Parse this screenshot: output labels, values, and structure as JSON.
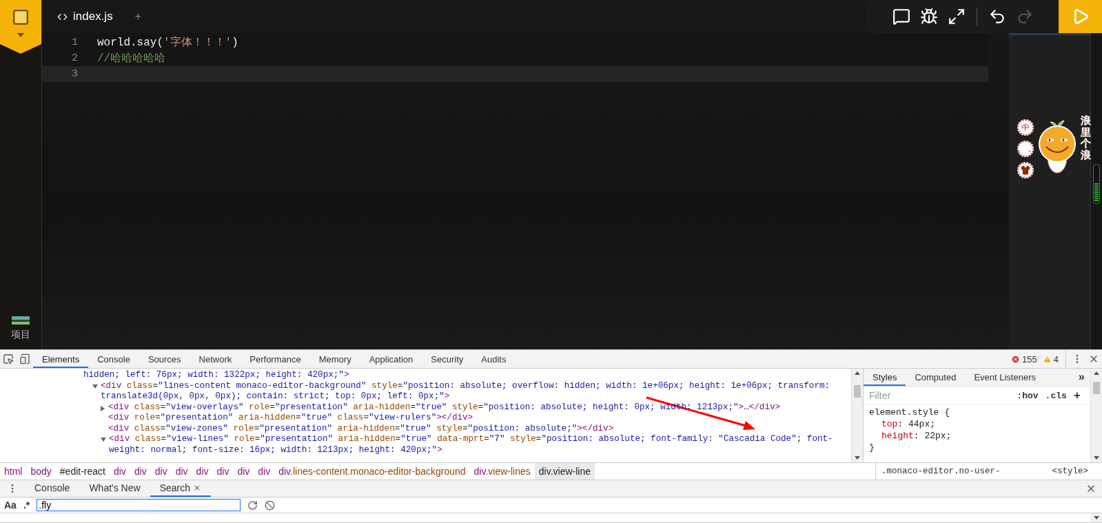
{
  "sidebar": {
    "items": [
      {
        "label": "项目"
      }
    ]
  },
  "editor": {
    "tabs": [
      {
        "label": "index.js",
        "selected": true
      }
    ],
    "add_tab": "+",
    "lines": [
      {
        "number": "1",
        "current": false,
        "tokens": [
          {
            "kind": "code",
            "text": "world.say("
          },
          {
            "kind": "string",
            "text": "'字体！！！'"
          },
          {
            "kind": "code",
            "text": ")"
          }
        ]
      },
      {
        "number": "2",
        "current": false,
        "tokens": [
          {
            "kind": "comment",
            "text": "//哈哈哈哈哈"
          }
        ]
      },
      {
        "number": "3",
        "current": true
      }
    ]
  },
  "toolbar": {
    "groups": [
      {
        "buttons": [
          {
            "kind": "comment",
            "disabled": false
          },
          {
            "kind": "bug",
            "disabled": false
          },
          {
            "kind": "fullscreen",
            "disabled": false
          }
        ]
      },
      {
        "buttons": [
          {
            "kind": "undo",
            "disabled": false
          },
          {
            "kind": "redo",
            "disabled": true
          }
        ]
      }
    ],
    "run": {
      "disabled": false
    }
  },
  "sticker": {
    "buttons": [
      {
        "kind": "text",
        "label": "中"
      },
      {
        "kind": "text",
        "label": "。，"
      },
      {
        "kind": "shirt"
      }
    ],
    "caption": "浪里个浪"
  },
  "devtools": {
    "tabs": [
      {
        "label": "Elements",
        "selected": true
      },
      {
        "label": "Console",
        "selected": false
      },
      {
        "label": "Sources",
        "selected": false
      },
      {
        "label": "Network",
        "selected": false
      },
      {
        "label": "Performance",
        "selected": false
      },
      {
        "label": "Memory",
        "selected": false
      },
      {
        "label": "Application",
        "selected": false
      },
      {
        "label": "Security",
        "selected": false
      },
      {
        "label": "Audits",
        "selected": false
      }
    ],
    "errors": "155",
    "warnings": "4",
    "dom": [
      {
        "kind": "fragment",
        "tokens": [
          {
            "kind": "value",
            "text": "hidden; left: 76px; width: 1322px; height: 420px;\""
          },
          {
            "kind": "tag",
            "text": ">"
          }
        ]
      },
      {
        "kind": "element",
        "expanded": true,
        "tokens": [
          {
            "kind": "tag",
            "text": "<div"
          },
          {
            "kind": "attr",
            "text": " class"
          },
          {
            "kind": "plain",
            "text": "="
          },
          {
            "kind": "value",
            "text": "\"lines-content monaco-editor-background\""
          },
          {
            "kind": "attr",
            "text": " style"
          },
          {
            "kind": "plain",
            "text": "="
          },
          {
            "kind": "value",
            "text": "\"position: absolute; overflow: hidden; width: 1e+06px; height: 1e+06px; transform: translate3d(0px, 0px, 0px); contain: strict; top: 0px; left: 0px;\""
          },
          {
            "kind": "tag",
            "text": ">"
          }
        ],
        "children": [
          {
            "kind": "element",
            "expanded": false,
            "tokens": [
              {
                "kind": "tag",
                "text": "<div"
              },
              {
                "kind": "attr",
                "text": " class"
              },
              {
                "kind": "plain",
                "text": "="
              },
              {
                "kind": "value",
                "text": "\"view-overlays\""
              },
              {
                "kind": "attr",
                "text": " role"
              },
              {
                "kind": "plain",
                "text": "="
              },
              {
                "kind": "value",
                "text": "\"presentation\""
              },
              {
                "kind": "attr",
                "text": " aria-hidden"
              },
              {
                "kind": "plain",
                "text": "="
              },
              {
                "kind": "value",
                "text": "\"true\""
              },
              {
                "kind": "attr",
                "text": " style"
              },
              {
                "kind": "plain",
                "text": "="
              },
              {
                "kind": "value",
                "text": "\"position: absolute; height: 0px; width: 1213px;\""
              },
              {
                "kind": "tag",
                "text": ">"
              },
              {
                "kind": "plain",
                "text": "…"
              },
              {
                "kind": "tag",
                "text": "</div>"
              }
            ]
          },
          {
            "kind": "element",
            "tokens": [
              {
                "kind": "tag",
                "text": "<div"
              },
              {
                "kind": "attr",
                "text": " role"
              },
              {
                "kind": "plain",
                "text": "="
              },
              {
                "kind": "value",
                "text": "\"presentation\""
              },
              {
                "kind": "attr",
                "text": " aria-hidden"
              },
              {
                "kind": "plain",
                "text": "="
              },
              {
                "kind": "value",
                "text": "\"true\""
              },
              {
                "kind": "attr",
                "text": " class"
              },
              {
                "kind": "plain",
                "text": "="
              },
              {
                "kind": "value",
                "text": "\"view-rulers\""
              },
              {
                "kind": "tag",
                "text": "></div>"
              }
            ]
          },
          {
            "kind": "element",
            "tokens": [
              {
                "kind": "tag",
                "text": "<div"
              },
              {
                "kind": "attr",
                "text": " class"
              },
              {
                "kind": "plain",
                "text": "="
              },
              {
                "kind": "value",
                "text": "\"view-zones\""
              },
              {
                "kind": "attr",
                "text": " role"
              },
              {
                "kind": "plain",
                "text": "="
              },
              {
                "kind": "value",
                "text": "\"presentation\""
              },
              {
                "kind": "attr",
                "text": " aria-hidden"
              },
              {
                "kind": "plain",
                "text": "="
              },
              {
                "kind": "value",
                "text": "\"true\""
              },
              {
                "kind": "attr",
                "text": " style"
              },
              {
                "kind": "plain",
                "text": "="
              },
              {
                "kind": "value",
                "text": "\"position: absolute;\""
              },
              {
                "kind": "tag",
                "text": "></div>"
              }
            ]
          },
          {
            "kind": "element",
            "expanded": true,
            "tokens": [
              {
                "kind": "tag",
                "text": "<div"
              },
              {
                "kind": "attr",
                "text": " class"
              },
              {
                "kind": "plain",
                "text": "="
              },
              {
                "kind": "value",
                "text": "\"view-lines\""
              },
              {
                "kind": "attr",
                "text": " role"
              },
              {
                "kind": "plain",
                "text": "="
              },
              {
                "kind": "value",
                "text": "\"presentation\""
              },
              {
                "kind": "attr",
                "text": " aria-hidden"
              },
              {
                "kind": "plain",
                "text": "="
              },
              {
                "kind": "value",
                "text": "\"true\""
              },
              {
                "kind": "attr",
                "text": " data-mprt"
              },
              {
                "kind": "plain",
                "text": "="
              },
              {
                "kind": "value",
                "text": "\"7\""
              },
              {
                "kind": "attr",
                "text": " style"
              },
              {
                "kind": "plain",
                "text": "="
              },
              {
                "kind": "value",
                "text": "\"position: absolute; font-family: \"Cascadia Code\"; font-weight: normal; font-size: 16px; width: 1213px; height: 420px;\""
              },
              {
                "kind": "tag",
                "text": ">"
              }
            ]
          }
        ]
      }
    ],
    "breadcrumbs": [
      {
        "tag": "html",
        "selected": false
      },
      {
        "tag": "body",
        "selected": false
      },
      {
        "id": "#edit-react",
        "selected": false
      },
      {
        "tag": "div",
        "selected": false
      },
      {
        "tag": "div",
        "selected": false
      },
      {
        "tag": "div",
        "selected": false
      },
      {
        "tag": "div",
        "selected": false
      },
      {
        "tag": "div",
        "selected": false
      },
      {
        "tag": "div",
        "selected": false
      },
      {
        "tag": "div",
        "selected": false
      },
      {
        "tag": "div",
        "selected": false
      },
      {
        "tag": "div",
        "cls": ".lines-content.monaco-editor-background",
        "selected": false
      },
      {
        "tag": "div",
        "cls": ".view-lines",
        "selected": false
      },
      {
        "tag": "div",
        "cls": ".view-line",
        "selected": true
      }
    ],
    "styles": {
      "tabs": [
        {
          "label": "Styles",
          "selected": true
        },
        {
          "label": "Computed",
          "selected": false
        },
        {
          "label": "Event Listeners",
          "selected": false
        }
      ],
      "more": "»",
      "filter_placeholder": "Filter",
      "hov": ":hov",
      "cls": ".cls",
      "add": "+",
      "rule": {
        "selector": "element.style {",
        "props": [
          {
            "name": "top",
            "value": ": 44px;"
          },
          {
            "name": "height",
            "value": ": 22px;"
          }
        ],
        "close": "}"
      },
      "next_rule": {
        "selector": ".monaco-editor.no-user-",
        "source": "<style>"
      }
    },
    "drawer": {
      "tabs": [
        {
          "label": "Console",
          "selected": false,
          "closable": false
        },
        {
          "label": "What's New",
          "selected": false,
          "closable": false
        },
        {
          "label": "Search",
          "selected": true,
          "closable": true
        }
      ],
      "search": {
        "case": "Aa",
        "regex": ".*",
        "value": ".fly"
      }
    }
  }
}
